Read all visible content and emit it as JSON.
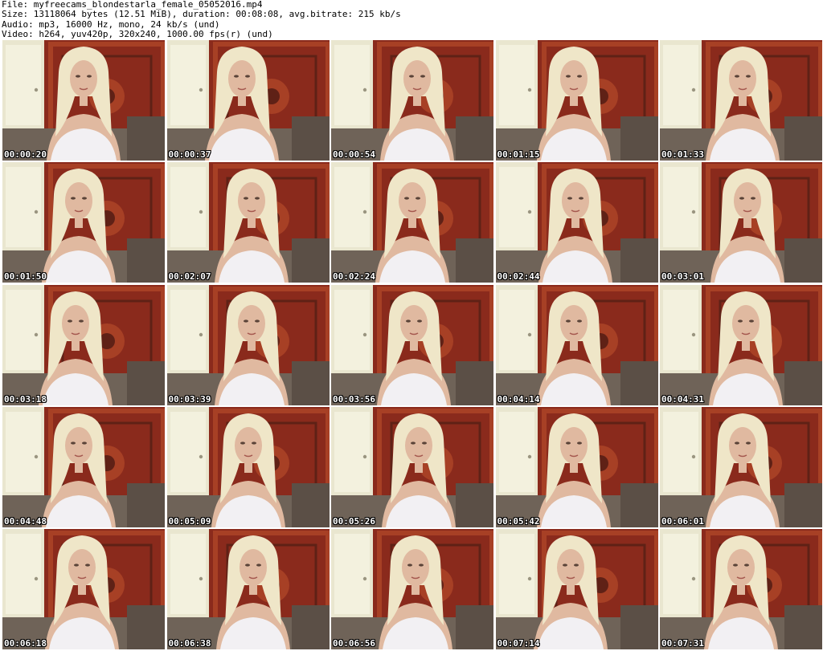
{
  "header": {
    "lines": [
      "File: myfreecams_blondestarla_female_05052016.mp4",
      "Size: 13118064 bytes (12.51 MiB), duration: 00:08:08, avg.bitrate: 215 kb/s",
      "Audio: mp3, 16000 Hz, mono, 24 kb/s (und)",
      "Video: h264, yuv420p, 320x240, 1000.00 fps(r) (und)"
    ]
  },
  "grid": {
    "columns": 5,
    "rows": 5,
    "timestamps": [
      "00:00:20",
      "00:00:37",
      "00:00:54",
      "00:01:15",
      "00:01:33",
      "00:01:50",
      "00:02:07",
      "00:02:24",
      "00:02:44",
      "00:03:01",
      "00:03:18",
      "00:03:39",
      "00:03:56",
      "00:04:14",
      "00:04:31",
      "00:04:48",
      "00:05:09",
      "00:05:26",
      "00:05:42",
      "00:06:01",
      "00:06:18",
      "00:06:38",
      "00:06:56",
      "00:07:14",
      "00:07:31"
    ]
  },
  "colors": {
    "door": "#e9e6cf",
    "rug": "#8a2a1c",
    "rug_pattern": "#c0532e",
    "hair": "#efe6c8",
    "skin": "#e0b9a0",
    "top": "#f2f0f3",
    "couch": "#6f6358"
  }
}
